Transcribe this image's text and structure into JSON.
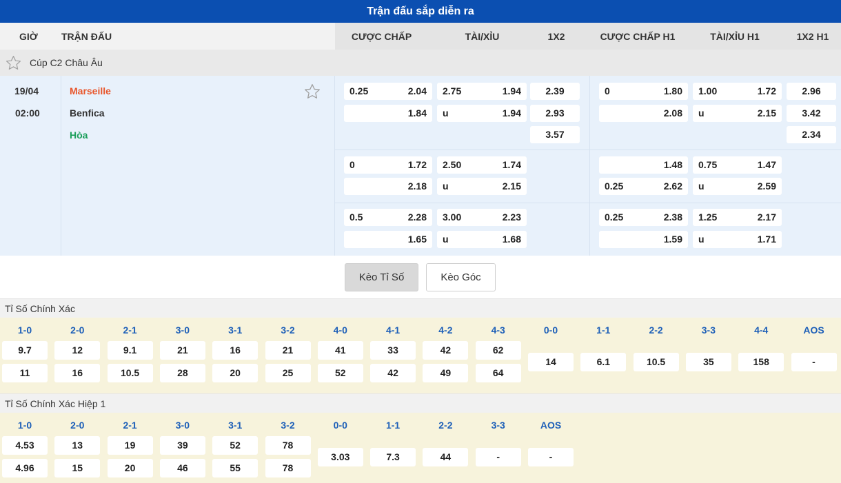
{
  "title": "Trận đấu sắp diễn ra",
  "headers": {
    "time": "GIỜ",
    "match": "TRẬN ĐẤU",
    "handicap": "CƯỢC CHẤP",
    "over_under": "TÀI/XỈU",
    "x12": "1X2",
    "handicap_h1": "CƯỢC CHẤP H1",
    "over_under_h1": "TÀI/XỈU H1",
    "x12_h1": "1X2 H1"
  },
  "league": {
    "name": "Cúp C2 Châu Âu",
    "icon": "star-outline-icon"
  },
  "match": {
    "date": "19/04",
    "time": "02:00",
    "home": "Marseille",
    "away": "Benfica",
    "draw": "Hòa",
    "home_color": "#e8552a",
    "draw_color": "#1a9e5a",
    "icon": "star-outline-icon"
  },
  "odds_rows": [
    {
      "hdp": {
        "line_top": "0.25",
        "top": "2.04",
        "line_bottom": "",
        "bottom": "1.84"
      },
      "ou": {
        "line": "2.75",
        "over": "1.94",
        "under_label": "u",
        "under": "1.94"
      },
      "x12": [
        "2.39",
        "2.93",
        "3.57"
      ],
      "hdp_h1": {
        "line_top": "0",
        "top": "1.80",
        "line_bottom": "",
        "bottom": "2.08"
      },
      "ou_h1": {
        "line": "1.00",
        "over": "1.72",
        "under_label": "u",
        "under": "2.15"
      },
      "x12_h1": [
        "2.96",
        "3.42",
        "2.34"
      ]
    },
    {
      "hdp": {
        "line_top": "0",
        "top": "1.72",
        "line_bottom": "",
        "bottom": "2.18"
      },
      "ou": {
        "line": "2.50",
        "over": "1.74",
        "under_label": "u",
        "under": "2.15"
      },
      "hdp_h1": {
        "line_top": "",
        "top": "1.48",
        "line_bottom": "0.25",
        "bottom": "2.62"
      },
      "ou_h1": {
        "line": "0.75",
        "over": "1.47",
        "under_label": "u",
        "under": "2.59"
      }
    },
    {
      "hdp": {
        "line_top": "0.5",
        "top": "2.28",
        "line_bottom": "",
        "bottom": "1.65"
      },
      "ou": {
        "line": "3.00",
        "over": "2.23",
        "under_label": "u",
        "under": "1.68"
      },
      "hdp_h1": {
        "line_top": "0.25",
        "top": "2.38",
        "line_bottom": "",
        "bottom": "1.59"
      },
      "ou_h1": {
        "line": "1.25",
        "over": "2.17",
        "under_label": "u",
        "under": "1.71"
      }
    }
  ],
  "tabs": {
    "score": "Kèo Tỉ Số",
    "corner": "Kèo Góc"
  },
  "exact_score": {
    "title": "Tỉ Số Chính Xác",
    "home_labels": [
      "1-0",
      "2-0",
      "2-1",
      "3-0",
      "3-1",
      "3-2",
      "4-0",
      "4-1",
      "4-2",
      "4-3"
    ],
    "home_row1": [
      "9.7",
      "12",
      "9.1",
      "21",
      "16",
      "21",
      "41",
      "33",
      "42",
      "62"
    ],
    "home_row2": [
      "11",
      "16",
      "10.5",
      "28",
      "20",
      "25",
      "52",
      "42",
      "49",
      "64"
    ],
    "draw_labels": [
      "0-0",
      "1-1",
      "2-2",
      "3-3",
      "4-4",
      "AOS"
    ],
    "draw_values": [
      "14",
      "6.1",
      "10.5",
      "35",
      "158",
      "-"
    ]
  },
  "exact_score_h1": {
    "title": "Tỉ Số Chính Xác Hiệp 1",
    "home_labels": [
      "1-0",
      "2-0",
      "2-1",
      "3-0",
      "3-1",
      "3-2"
    ],
    "home_row1": [
      "4.53",
      "13",
      "19",
      "39",
      "52",
      "78"
    ],
    "home_row2": [
      "4.96",
      "15",
      "20",
      "46",
      "55",
      "78"
    ],
    "draw_labels": [
      "0-0",
      "1-1",
      "2-2",
      "3-3",
      "AOS"
    ],
    "draw_values": [
      "3.03",
      "7.3",
      "44",
      "-",
      "-"
    ]
  }
}
